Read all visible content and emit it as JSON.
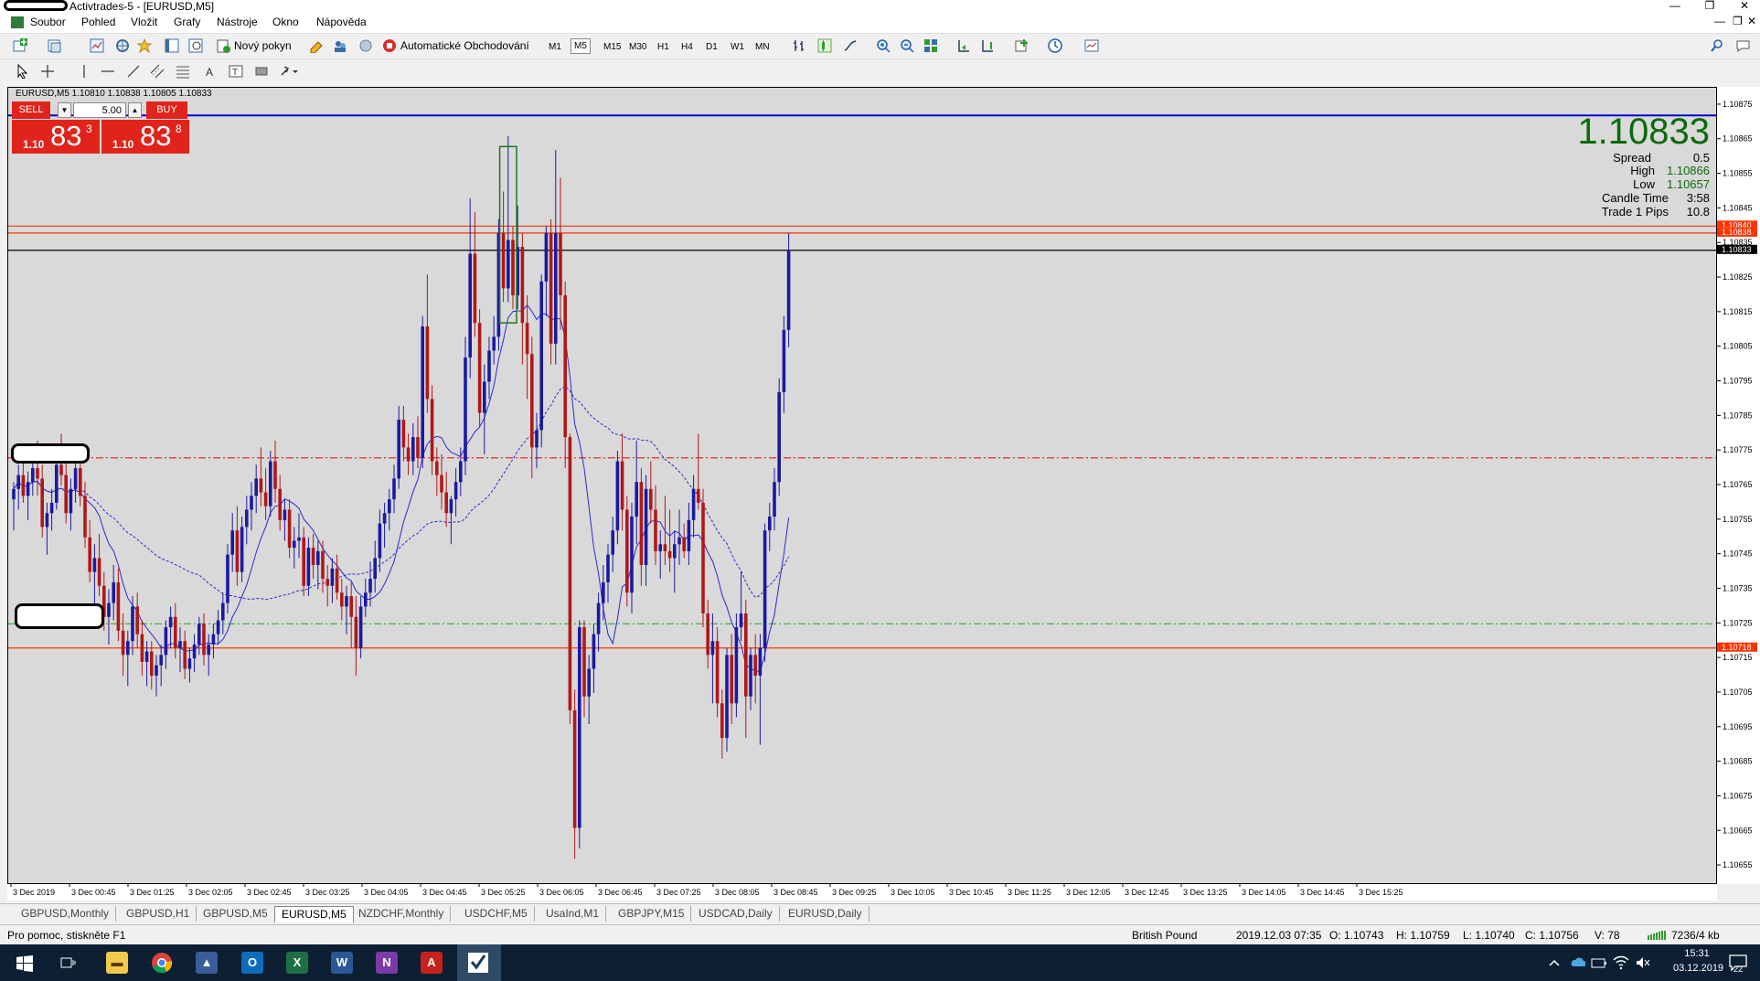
{
  "window": {
    "title": "Activtrades-5 - [EURUSD,M5]",
    "controls": [
      "—",
      "❐",
      "✕"
    ],
    "child_controls": [
      "—",
      "❐",
      "✕"
    ]
  },
  "menu": [
    "Soubor",
    "Pohled",
    "Vložit",
    "Grafy",
    "Nástroje",
    "Okno",
    "Nápověda"
  ],
  "toolbar": {
    "new_order_label": "Nový pokyn",
    "auto_trading_label": "Automatické Obchodování",
    "timeframes": [
      "M1",
      "M5",
      "M15",
      "M30",
      "H1",
      "H4",
      "D1",
      "W1",
      "MN"
    ],
    "active_timeframe": "M5"
  },
  "chart": {
    "header": "EURUSD,M5  1.10810 1.10838 1.10805 1.10833",
    "one_click": {
      "sell_label": "SELL",
      "buy_label": "BUY",
      "lot": "5.00",
      "bid_prefix": "1.10",
      "bid_big": "83",
      "bid_sup": "3",
      "ask_prefix": "1.10",
      "ask_big": "83",
      "ask_sup": "8"
    },
    "info": {
      "price": "1.10833",
      "spread_label": "Spread",
      "spread": "0.5",
      "high_label": "High",
      "high": "1.10866",
      "low_label": "Low",
      "low": "1.10657",
      "candle_time_label": "Candle Time",
      "candle_time": "3:58",
      "trade_pips_label": "Trade 1 Pips",
      "trade_pips": "10.8"
    }
  },
  "chart_data": {
    "type": "candlestick",
    "symbol": "EURUSD",
    "timeframe": "M5",
    "ylim": [
      1.1065,
      1.1088
    ],
    "y_ticks": [
      "1.10875",
      "1.10865",
      "1.10855",
      "1.10845",
      "1.10835",
      "1.10825",
      "1.10815",
      "1.10805",
      "1.10795",
      "1.10785",
      "1.10775",
      "1.10765",
      "1.10755",
      "1.10745",
      "1.10735",
      "1.10725",
      "1.10715",
      "1.10705",
      "1.10695",
      "1.10685",
      "1.10675",
      "1.10665",
      "1.10655"
    ],
    "x_ticks": [
      "3 Dec 2019",
      "3 Dec 00:45",
      "3 Dec 01:25",
      "3 Dec 02:05",
      "3 Dec 02:45",
      "3 Dec 03:25",
      "3 Dec 04:05",
      "3 Dec 04:45",
      "3 Dec 05:25",
      "3 Dec 06:05",
      "3 Dec 06:45",
      "3 Dec 07:25",
      "3 Dec 08:05",
      "3 Dec 08:45",
      "3 Dec 09:25",
      "3 Dec 10:05",
      "3 Dec 10:45",
      "3 Dec 11:25",
      "3 Dec 12:05",
      "3 Dec 12:45",
      "3 Dec 13:25",
      "3 Dec 14:05",
      "3 Dec 14:45",
      "3 Dec 15:25"
    ],
    "price_labels": [
      {
        "text": "1.10840",
        "price": 1.1084,
        "color": "#ff3300"
      },
      {
        "text": "1.10838",
        "price": 1.10838,
        "color": "#ff3300"
      },
      {
        "text": "1.10833",
        "price": 1.10833,
        "color": "#000000"
      },
      {
        "text": "1.10718",
        "price": 1.10718,
        "color": "#ff3300"
      }
    ],
    "hlines": [
      {
        "price": 1.10872,
        "color": "#0000cc",
        "style": "solid"
      },
      {
        "price": 1.1084,
        "color": "#ff3300",
        "style": "solid"
      },
      {
        "price": 1.10838,
        "color": "#ff3300",
        "style": "solid"
      },
      {
        "price": 1.10833,
        "color": "#000000",
        "style": "solid"
      },
      {
        "price": 1.10773,
        "color": "#e03030",
        "style": "dashdot"
      },
      {
        "price": 1.10725,
        "color": "#3aa83a",
        "style": "dashdot"
      },
      {
        "price": 1.10718,
        "color": "#ff3300",
        "style": "solid"
      }
    ],
    "up_color": "#1a1aa0",
    "down_color": "#b01818",
    "candles": [
      [
        1.10761,
        1.10766,
        1.10752,
        1.10764
      ],
      [
        1.10764,
        1.10771,
        1.10758,
        1.10768
      ],
      [
        1.10768,
        1.10776,
        1.1076,
        1.10762
      ],
      [
        1.10762,
        1.10769,
        1.10755,
        1.10766
      ],
      [
        1.10766,
        1.10772,
        1.10762,
        1.1077
      ],
      [
        1.1077,
        1.10778,
        1.10762,
        1.10767
      ],
      [
        1.10767,
        1.10771,
        1.1075,
        1.10753
      ],
      [
        1.10753,
        1.1076,
        1.10745,
        1.10757
      ],
      [
        1.10757,
        1.10764,
        1.10752,
        1.1076
      ],
      [
        1.1076,
        1.10774,
        1.10758,
        1.10771
      ],
      [
        1.10771,
        1.1078,
        1.10765,
        1.10768
      ],
      [
        1.10768,
        1.10772,
        1.10754,
        1.10757
      ],
      [
        1.10757,
        1.10767,
        1.10752,
        1.10764
      ],
      [
        1.10764,
        1.10774,
        1.1076,
        1.1077
      ],
      [
        1.1077,
        1.10777,
        1.10759,
        1.10762
      ],
      [
        1.10762,
        1.10766,
        1.10747,
        1.1075
      ],
      [
        1.1075,
        1.10755,
        1.10737,
        1.1074
      ],
      [
        1.1074,
        1.10748,
        1.1073,
        1.10744
      ],
      [
        1.10744,
        1.10751,
        1.10733,
        1.10736
      ],
      [
        1.10736,
        1.1074,
        1.10723,
        1.10727
      ],
      [
        1.10727,
        1.10735,
        1.10719,
        1.10731
      ],
      [
        1.10731,
        1.10742,
        1.10726,
        1.10737
      ],
      [
        1.10737,
        1.10741,
        1.1072,
        1.10723
      ],
      [
        1.10723,
        1.10728,
        1.1071,
        1.10716
      ],
      [
        1.10716,
        1.10723,
        1.10707,
        1.1072
      ],
      [
        1.1072,
        1.10733,
        1.10716,
        1.1073
      ],
      [
        1.1073,
        1.10734,
        1.10718,
        1.10722
      ],
      [
        1.10722,
        1.10726,
        1.1071,
        1.10714
      ],
      [
        1.10714,
        1.1072,
        1.10707,
        1.10717
      ],
      [
        1.10717,
        1.1072,
        1.10706,
        1.1071
      ],
      [
        1.1071,
        1.10716,
        1.10704,
        1.10713
      ],
      [
        1.10713,
        1.10719,
        1.10707,
        1.10716
      ],
      [
        1.10716,
        1.10726,
        1.10712,
        1.10724
      ],
      [
        1.10724,
        1.1073,
        1.10718,
        1.10727
      ],
      [
        1.10727,
        1.10731,
        1.10715,
        1.10718
      ],
      [
        1.10718,
        1.10724,
        1.10711,
        1.1072
      ],
      [
        1.1072,
        1.10723,
        1.10709,
        1.10712
      ],
      [
        1.10712,
        1.10718,
        1.10708,
        1.10715
      ],
      [
        1.10715,
        1.10722,
        1.10711,
        1.10719
      ],
      [
        1.10719,
        1.10727,
        1.10716,
        1.10725
      ],
      [
        1.10725,
        1.10728,
        1.10713,
        1.10716
      ],
      [
        1.10716,
        1.10722,
        1.1071,
        1.10719
      ],
      [
        1.10719,
        1.10725,
        1.10715,
        1.10722
      ],
      [
        1.10722,
        1.10729,
        1.10719,
        1.10726
      ],
      [
        1.10726,
        1.10734,
        1.10722,
        1.10731
      ],
      [
        1.10731,
        1.10748,
        1.10728,
        1.10745
      ],
      [
        1.10745,
        1.10757,
        1.1074,
        1.10752
      ],
      [
        1.10752,
        1.10759,
        1.10736,
        1.1074
      ],
      [
        1.1074,
        1.10756,
        1.10737,
        1.10753
      ],
      [
        1.10753,
        1.10762,
        1.10748,
        1.10758
      ],
      [
        1.10758,
        1.10766,
        1.10752,
        1.10762
      ],
      [
        1.10762,
        1.10771,
        1.10757,
        1.10767
      ],
      [
        1.10767,
        1.10776,
        1.10759,
        1.10763
      ],
      [
        1.10763,
        1.1077,
        1.10755,
        1.10759
      ],
      [
        1.10759,
        1.10775,
        1.10756,
        1.10772
      ],
      [
        1.10772,
        1.10778,
        1.1076,
        1.10764
      ],
      [
        1.10764,
        1.10768,
        1.10752,
        1.10755
      ],
      [
        1.10755,
        1.10761,
        1.10749,
        1.10758
      ],
      [
        1.10758,
        1.10761,
        1.10744,
        1.10747
      ],
      [
        1.10747,
        1.10753,
        1.10741,
        1.10749
      ],
      [
        1.10749,
        1.10757,
        1.10744,
        1.1075
      ],
      [
        1.1075,
        1.10753,
        1.10733,
        1.10736
      ],
      [
        1.10736,
        1.1075,
        1.10733,
        1.10747
      ],
      [
        1.10747,
        1.10751,
        1.10738,
        1.10742
      ],
      [
        1.10742,
        1.10749,
        1.10735,
        1.10746
      ],
      [
        1.10746,
        1.10749,
        1.10734,
        1.10738
      ],
      [
        1.10738,
        1.10742,
        1.1073,
        1.10736
      ],
      [
        1.10736,
        1.10744,
        1.10731,
        1.10741
      ],
      [
        1.10741,
        1.10745,
        1.10732,
        1.10734
      ],
      [
        1.10734,
        1.10738,
        1.10726,
        1.1073
      ],
      [
        1.1073,
        1.10736,
        1.10722,
        1.10733
      ],
      [
        1.10733,
        1.10737,
        1.10718,
        1.10727
      ],
      [
        1.10727,
        1.10733,
        1.1071,
        1.10718
      ],
      [
        1.10718,
        1.10733,
        1.10715,
        1.1073
      ],
      [
        1.1073,
        1.10738,
        1.10727,
        1.10734
      ],
      [
        1.10734,
        1.10743,
        1.1073,
        1.10738
      ],
      [
        1.10738,
        1.10749,
        1.10734,
        1.10744
      ],
      [
        1.10744,
        1.10758,
        1.1074,
        1.10754
      ],
      [
        1.10754,
        1.1076,
        1.10747,
        1.10757
      ],
      [
        1.10757,
        1.10764,
        1.10752,
        1.10761
      ],
      [
        1.10761,
        1.10771,
        1.10757,
        1.10767
      ],
      [
        1.10767,
        1.10788,
        1.10764,
        1.10784
      ],
      [
        1.10784,
        1.10788,
        1.10772,
        1.10776
      ],
      [
        1.10776,
        1.1078,
        1.10768,
        1.10772
      ],
      [
        1.10772,
        1.10783,
        1.10768,
        1.10779
      ],
      [
        1.10779,
        1.10785,
        1.1077,
        1.10773
      ],
      [
        1.10773,
        1.10814,
        1.1077,
        1.10811
      ],
      [
        1.10811,
        1.10826,
        1.10786,
        1.1079
      ],
      [
        1.1079,
        1.10794,
        1.10768,
        1.10772
      ],
      [
        1.10772,
        1.10776,
        1.10762,
        1.10768
      ],
      [
        1.10768,
        1.10774,
        1.10758,
        1.10763
      ],
      [
        1.10763,
        1.10769,
        1.10753,
        1.10757
      ],
      [
        1.10757,
        1.10762,
        1.10748,
        1.10761
      ],
      [
        1.10761,
        1.1077,
        1.10756,
        1.10766
      ],
      [
        1.10766,
        1.10776,
        1.10762,
        1.10772
      ],
      [
        1.10772,
        1.10808,
        1.10768,
        1.10802
      ],
      [
        1.10802,
        1.10848,
        1.10796,
        1.10832
      ],
      [
        1.10832,
        1.10844,
        1.10808,
        1.10812
      ],
      [
        1.10812,
        1.10816,
        1.10782,
        1.10786
      ],
      [
        1.10786,
        1.108,
        1.10774,
        1.10795
      ],
      [
        1.10795,
        1.10808,
        1.1079,
        1.10804
      ],
      [
        1.10804,
        1.10814,
        1.108,
        1.10808
      ],
      [
        1.10808,
        1.10842,
        1.10804,
        1.10838
      ],
      [
        1.10838,
        1.1085,
        1.10818,
        1.10822
      ],
      [
        1.10822,
        1.10866,
        1.10818,
        1.10836
      ],
      [
        1.10836,
        1.1084,
        1.10816,
        1.1082
      ],
      [
        1.1082,
        1.10846,
        1.10816,
        1.10834
      ],
      [
        1.10834,
        1.10838,
        1.108,
        1.10812
      ],
      [
        1.10812,
        1.1082,
        1.1079,
        1.10803
      ],
      [
        1.10803,
        1.10808,
        1.10767,
        1.10776
      ],
      [
        1.10776,
        1.10786,
        1.1077,
        1.10781
      ],
      [
        1.10781,
        1.10826,
        1.10776,
        1.10824
      ],
      [
        1.10824,
        1.1084,
        1.10814,
        1.10838
      ],
      [
        1.10838,
        1.10842,
        1.108,
        1.10806
      ],
      [
        1.10806,
        1.10862,
        1.108,
        1.10838
      ],
      [
        1.10838,
        1.10854,
        1.1081,
        1.1082
      ],
      [
        1.1082,
        1.10824,
        1.1077,
        1.10779
      ],
      [
        1.10779,
        1.1078,
        1.10696,
        1.107
      ],
      [
        1.107,
        1.10706,
        1.10657,
        1.10666
      ],
      [
        1.10666,
        1.10726,
        1.1066,
        1.10724
      ],
      [
        1.10724,
        1.10726,
        1.10698,
        1.10704
      ],
      [
        1.10704,
        1.10716,
        1.10696,
        1.10712
      ],
      [
        1.10712,
        1.10725,
        1.10705,
        1.10722
      ],
      [
        1.10722,
        1.10734,
        1.10717,
        1.10731
      ],
      [
        1.10731,
        1.10742,
        1.10726,
        1.10737
      ],
      [
        1.10737,
        1.10748,
        1.10731,
        1.10745
      ],
      [
        1.10745,
        1.10756,
        1.1074,
        1.10752
      ],
      [
        1.10752,
        1.10775,
        1.10748,
        1.10772
      ],
      [
        1.10772,
        1.1078,
        1.10752,
        1.10758
      ],
      [
        1.10758,
        1.10762,
        1.1073,
        1.10734
      ],
      [
        1.10734,
        1.1076,
        1.10728,
        1.10756
      ],
      [
        1.10756,
        1.10778,
        1.10748,
        1.10766
      ],
      [
        1.10766,
        1.1077,
        1.10736,
        1.10742
      ],
      [
        1.10742,
        1.10768,
        1.10736,
        1.10764
      ],
      [
        1.10764,
        1.10772,
        1.10754,
        1.10758
      ],
      [
        1.10758,
        1.10765,
        1.10742,
        1.10746
      ],
      [
        1.10746,
        1.10752,
        1.10738,
        1.10748
      ],
      [
        1.10748,
        1.10762,
        1.10742,
        1.10746
      ],
      [
        1.10746,
        1.10758,
        1.1074,
        1.10744
      ],
      [
        1.10744,
        1.10752,
        1.10734,
        1.10748
      ],
      [
        1.10748,
        1.10758,
        1.10742,
        1.1075
      ],
      [
        1.1075,
        1.10754,
        1.10744,
        1.10746
      ],
      [
        1.10746,
        1.1076,
        1.10742,
        1.10755
      ],
      [
        1.10755,
        1.10768,
        1.1075,
        1.10764
      ],
      [
        1.10764,
        1.1078,
        1.10758,
        1.1076
      ],
      [
        1.1076,
        1.10764,
        1.10724,
        1.10728
      ],
      [
        1.10728,
        1.10732,
        1.10712,
        1.10716
      ],
      [
        1.10716,
        1.10728,
        1.10702,
        1.1072
      ],
      [
        1.1072,
        1.10724,
        1.10698,
        1.10702
      ],
      [
        1.10702,
        1.10706,
        1.10686,
        1.10692
      ],
      [
        1.10692,
        1.10718,
        1.10688,
        1.10716
      ],
      [
        1.10716,
        1.10722,
        1.10696,
        1.10702
      ],
      [
        1.10702,
        1.10728,
        1.10698,
        1.10724
      ],
      [
        1.10724,
        1.1074,
        1.1072,
        1.10728
      ],
      [
        1.10728,
        1.10732,
        1.10692,
        1.10704
      ],
      [
        1.10704,
        1.10718,
        1.107,
        1.10716
      ],
      [
        1.10716,
        1.10722,
        1.10702,
        1.1071
      ],
      [
        1.1071,
        1.10722,
        1.1069,
        1.10718
      ],
      [
        1.10718,
        1.10754,
        1.10714,
        1.10752
      ],
      [
        1.10752,
        1.1076,
        1.10746,
        1.10756
      ],
      [
        1.10756,
        1.1077,
        1.10752,
        1.10766
      ],
      [
        1.10766,
        1.10796,
        1.10762,
        1.10792
      ],
      [
        1.10792,
        1.10814,
        1.10786,
        1.1081
      ],
      [
        1.1081,
        1.10838,
        1.10805,
        1.10833
      ]
    ],
    "trade_box": {
      "from_index": 103,
      "to_index": 105,
      "low": 1.10812,
      "high": 1.10863
    }
  },
  "tabs": [
    "GBPUSD,Monthly",
    "GBPUSD,H1",
    "GBPUSD,M5",
    "EURUSD,M5",
    "NZDCHF,Monthly",
    "USDCHF,M5",
    "UsaInd,M1",
    "GBPJPY,M15",
    "USDCAD,Daily",
    "EURUSD,Daily"
  ],
  "active_tab": "EURUSD,M5",
  "status": {
    "help": "Pro pomoc, stiskněte F1",
    "profile": "British Pound",
    "datetime": "2019.12.03 07:35",
    "open": "O: 1.10743",
    "high": "H: 1.10759",
    "low": "L: 1.10740",
    "close": "C: 1.10756",
    "volume": "V: 78",
    "traffic": "7236/4 kb"
  },
  "taskbar": {
    "time": "15:31",
    "date": "03.12.2019",
    "notifications": "22"
  }
}
